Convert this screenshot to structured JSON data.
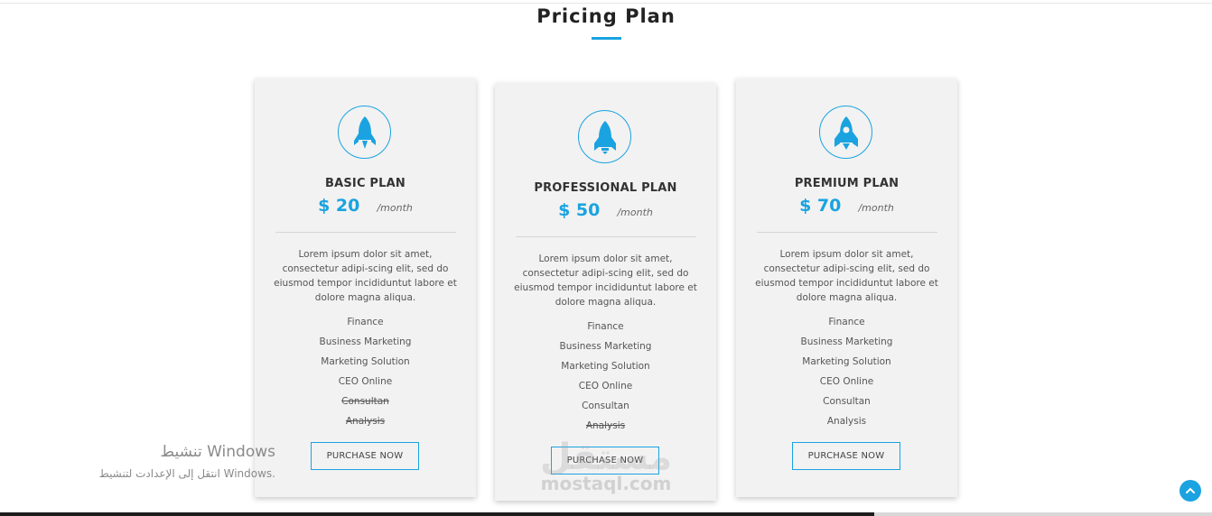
{
  "section": {
    "title": "Pricing Plan",
    "accent_color": "#1aa3e0"
  },
  "plans": [
    {
      "name": "BASIC PLAN",
      "price": "$ 20",
      "period": "/month",
      "icon": "rocket-icon",
      "description": "Lorem ipsum dolor sit amet, consectetur adipi-scing elit, sed do eiusmod tempor incididuntut labore et dolore magna aliqua.",
      "features": [
        {
          "label": "Finance",
          "included": true
        },
        {
          "label": "Business Marketing",
          "included": true
        },
        {
          "label": "Marketing Solution",
          "included": true
        },
        {
          "label": "CEO Online",
          "included": true
        },
        {
          "label": "Consultan",
          "included": false
        },
        {
          "label": "Analysis",
          "included": false
        }
      ],
      "button_label": "PURCHASE NOW"
    },
    {
      "name": "PROFESSIONAL PLAN",
      "price": "$ 50",
      "period": "/month",
      "icon": "rocket-icon",
      "description": "Lorem ipsum dolor sit amet, consectetur adipi-scing elit, sed do eiusmod tempor incididuntut labore et dolore magna aliqua.",
      "features": [
        {
          "label": "Finance",
          "included": true
        },
        {
          "label": "Business Marketing",
          "included": true
        },
        {
          "label": "Marketing Solution",
          "included": true
        },
        {
          "label": "CEO Online",
          "included": true
        },
        {
          "label": "Consultan",
          "included": true
        },
        {
          "label": "Analysis",
          "included": false
        }
      ],
      "button_label": "PURCHASE NOW"
    },
    {
      "name": "PREMIUM PLAN",
      "price": "$ 70",
      "period": "/month",
      "icon": "rocket-window-icon",
      "description": "Lorem ipsum dolor sit amet, consectetur adipi-scing elit, sed do eiusmod tempor incididuntut labore et dolore magna aliqua.",
      "features": [
        {
          "label": "Finance",
          "included": true
        },
        {
          "label": "Business Marketing",
          "included": true
        },
        {
          "label": "Marketing Solution",
          "included": true
        },
        {
          "label": "CEO Online",
          "included": true
        },
        {
          "label": "Consultan",
          "included": true
        },
        {
          "label": "Analysis",
          "included": true
        }
      ],
      "button_label": "PURCHASE NOW"
    }
  ],
  "watermark": {
    "logo_text": "مستقل",
    "url": "mostaql.com"
  },
  "windows_activation": {
    "title": "تنشيط Windows",
    "subtitle": "انتقل إلى الإعدادت لتنشيط Windows."
  },
  "scroll_top": {
    "icon": "chevron-up-icon"
  }
}
